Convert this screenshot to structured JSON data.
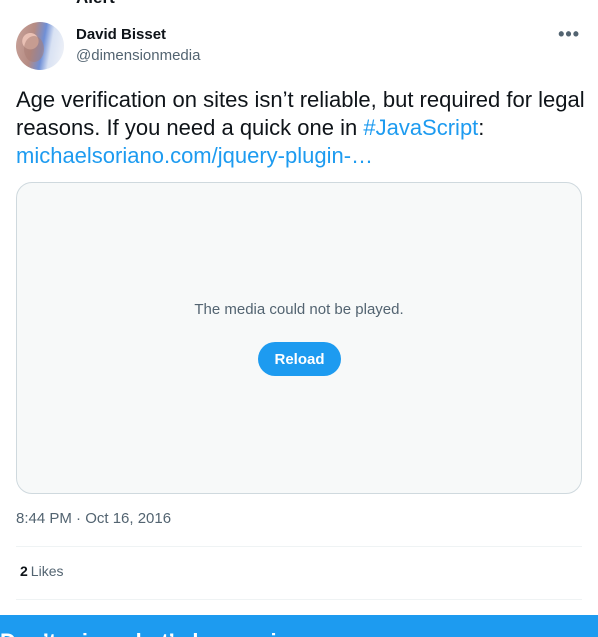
{
  "header": {
    "cut_off_text": "Alert",
    "name": "David Bisset",
    "handle": "@dimensionmedia",
    "more_icon": "more-horizontal-icon"
  },
  "tweet": {
    "text_part1": "Age verification on sites isn’t reliable, but required for legal reasons. If you need a quick one in ",
    "hashtag": "#JavaScript",
    "text_part2": ":",
    "link": "michaelsoriano.com/jquery-plugin-…"
  },
  "media": {
    "message": "The media could not be played.",
    "reload_label": "Reload"
  },
  "meta": {
    "timestamp": "8:44 PM · Oct 16, 2016",
    "likes_count": "2",
    "likes_label": "Likes"
  },
  "banner": {
    "text": "Don’t miss what’s happening"
  },
  "colors": {
    "accent": "#1d9bf0",
    "text": "#0f1419",
    "secondary": "#536471"
  }
}
